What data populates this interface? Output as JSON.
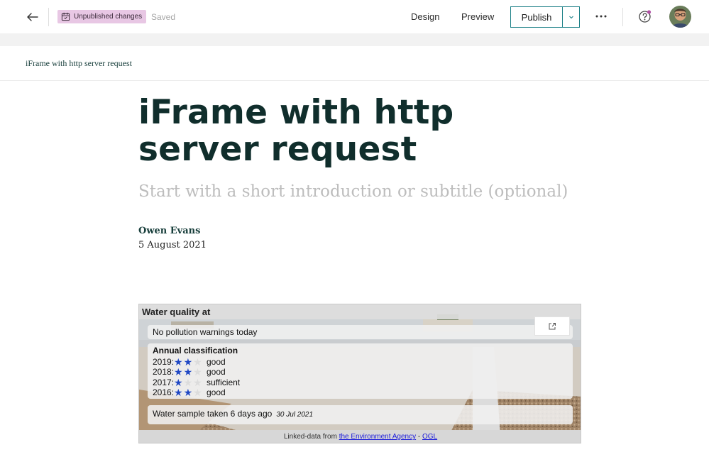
{
  "header": {
    "badge_label": "Unpublished changes",
    "saved_label": "Saved",
    "design_label": "Design",
    "preview_label": "Preview",
    "publish_label": "Publish"
  },
  "story": {
    "breadcrumb": "iFrame with http server request",
    "title": "iFrame with http server request",
    "subtitle_placeholder": "Start with a short introduction or subtitle (optional)",
    "author": "Owen Evans",
    "date": "5 August 2021"
  },
  "embed": {
    "title": "Water quality at",
    "warning": "No pollution warnings today",
    "classification_heading": "Annual classification",
    "classifications": [
      {
        "year": "2019:",
        "stars": 2,
        "rating": "good"
      },
      {
        "year": "2018:",
        "stars": 2,
        "rating": "good"
      },
      {
        "year": "2017:",
        "stars": 1,
        "rating": "sufficient"
      },
      {
        "year": "2016:",
        "stars": 2,
        "rating": "good"
      }
    ],
    "sample_text": "Water sample taken 6 days ago",
    "sample_date": "30 Jul 2021",
    "linked_prefix": "Linked-data from",
    "linked_agency": "the Environment Agency",
    "linked_sep": "-",
    "linked_licence": "OGL"
  },
  "colors": {
    "accent": "#1a7f86",
    "badge_bg": "#e8c7e4",
    "title_color": "#102e2c",
    "star_on": "#1f47c4"
  }
}
